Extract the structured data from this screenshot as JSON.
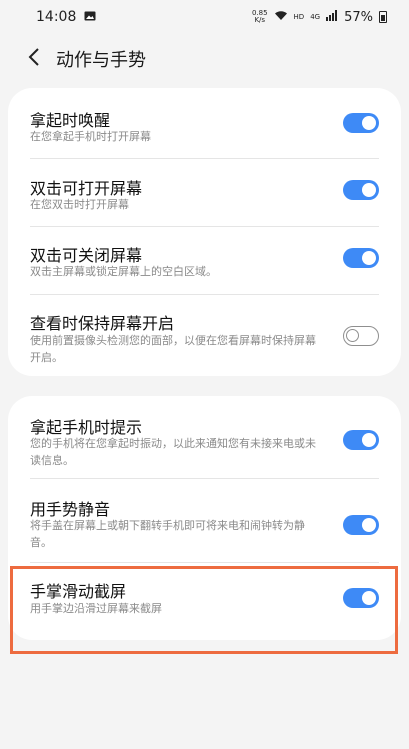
{
  "status": {
    "time": "14:08",
    "net_speed_top": "0.85",
    "net_speed_bottom": "K/s",
    "hd": "HD",
    "signal_label": "4G",
    "battery": "57%"
  },
  "header": {
    "title": "动作与手势"
  },
  "group1": [
    {
      "label": "拿起时唤醒",
      "desc": "在您拿起手机时打开屏幕",
      "on": true
    },
    {
      "label": "双击可打开屏幕",
      "desc": "在您双击时打开屏幕",
      "on": true
    },
    {
      "label": "双击可关闭屏幕",
      "desc": "双击主屏幕或锁定屏幕上的空白区域。",
      "on": true
    },
    {
      "label": "查看时保持屏幕开启",
      "desc": "使用前置摄像头检测您的面部，以便在您看屏幕时保持屏幕开启。",
      "on": false
    }
  ],
  "group2": [
    {
      "label": "拿起手机时提示",
      "desc": "您的手机将在您拿起时振动，以此来通知您有未接来电或未读信息。",
      "on": true
    },
    {
      "label": "用手势静音",
      "desc": "将手盖在屏幕上或朝下翻转手机即可将来电和闹钟转为静音。",
      "on": true
    },
    {
      "label": "手掌滑动截屏",
      "desc": "用手掌边沿滑过屏幕来截屏",
      "on": true
    }
  ],
  "colors": {
    "accent": "#3e8af6",
    "highlight": "#ed6b3f"
  }
}
